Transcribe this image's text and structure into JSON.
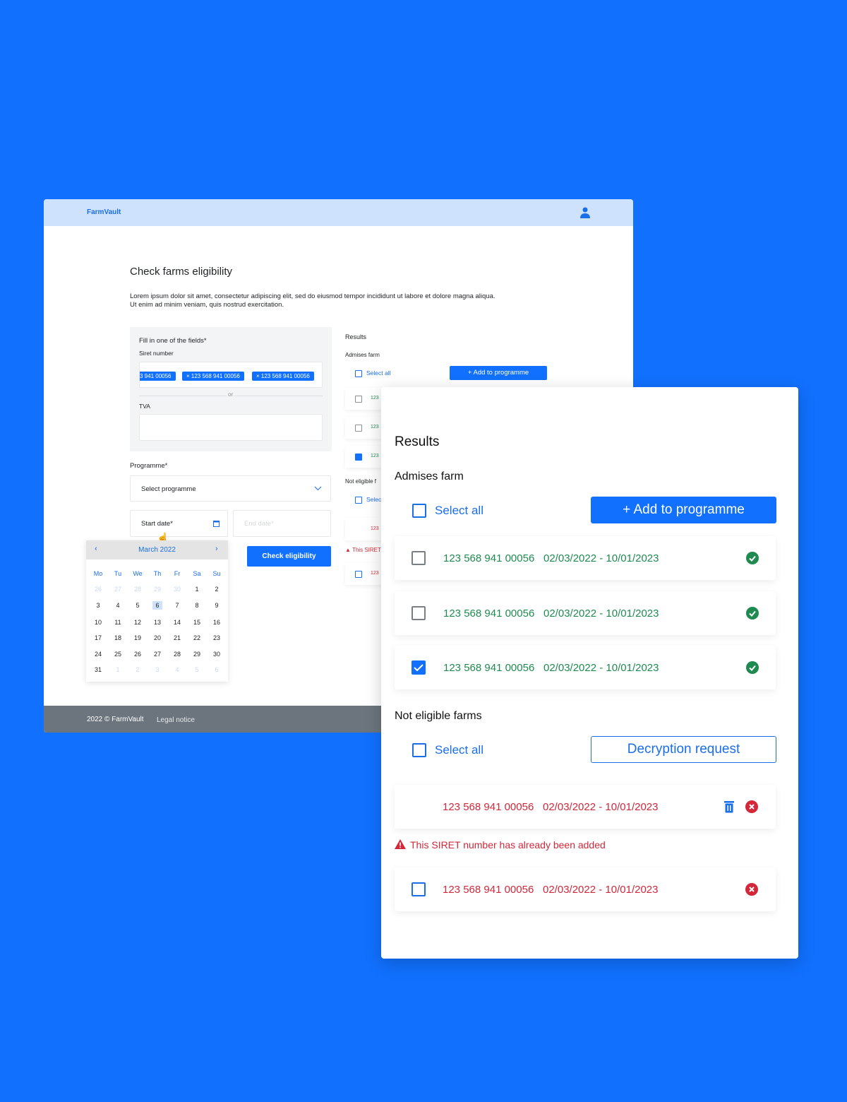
{
  "app": {
    "brand": "FarmVault"
  },
  "page": {
    "title": "Check farms eligibility",
    "description_line1": "Lorem ipsum dolor sit amet, consectetur adipiscing elit, sed do eiusmod tempor incididunt ut labore et dolore magna aliqua.",
    "description_line2": "Ut enim ad minim veniam, quis nostrud exercitation."
  },
  "form": {
    "fill_label": "Fill in one of the fields*",
    "siret_label": "Siret number",
    "siret_chips": [
      "3 941 00056",
      "× 123 568 941 00056",
      "× 123 568 941 00056"
    ],
    "or": "or",
    "tva_label": "TVA",
    "tva_value": "",
    "programme_label": "Programme*",
    "programme_placeholder": "Select programme",
    "start_date": "Start date*",
    "end_date_placeholder": "End date*",
    "check_button": "Check eligibility"
  },
  "calendar": {
    "month": "March 2022",
    "weekdays": [
      "Mo",
      "Tu",
      "We",
      "Th",
      "Fr",
      "Sa",
      "Su"
    ],
    "weeks": [
      [
        "26",
        "27",
        "28",
        "29",
        "30",
        "1",
        "2"
      ],
      [
        "3",
        "4",
        "5",
        "6",
        "7",
        "8",
        "9"
      ],
      [
        "10",
        "11",
        "12",
        "13",
        "14",
        "15",
        "16"
      ],
      [
        "17",
        "18",
        "19",
        "20",
        "21",
        "22",
        "23"
      ],
      [
        "24",
        "25",
        "26",
        "27",
        "28",
        "29",
        "30"
      ],
      [
        "31",
        "1",
        "2",
        "3",
        "4",
        "5",
        "6"
      ]
    ],
    "selected": "6"
  },
  "results": {
    "title": "Results",
    "admissible_title": "Admises farm",
    "select_all": "Select all",
    "add_button": "+ Add to programme",
    "admissible": [
      {
        "siret": "123 568 941 00056",
        "dates": "02/03/2022 - 10/01/2023",
        "checked": false
      },
      {
        "siret": "123 568 941 00056",
        "dates": "02/03/2022 - 10/01/2023",
        "checked": false
      },
      {
        "siret": "123 568 941 00056",
        "dates": "02/03/2022 - 10/01/2023",
        "checked": true
      }
    ],
    "not_eligible_title": "Not eligible farms",
    "not_eligible_title_short": "Not eligible f",
    "select_short": "Selec",
    "decryption_button": "Decryption request",
    "not_eligible": [
      {
        "siret": "123 568 941 00056",
        "dates": "02/03/2022 - 10/01/2023"
      },
      {
        "siret": "123 568 941 00056",
        "dates": "02/03/2022 - 10/01/2023"
      }
    ],
    "warning": "This SIRET number has already been added",
    "warning_short": "This SIRET",
    "short_siret": "123"
  },
  "footer": {
    "copyright": "2022 © FarmVault",
    "legal": "Legal notice"
  },
  "colors": {
    "background": "#1170fd",
    "accent": "#1170fd",
    "success": "#1f8a50",
    "error": "#d2283a",
    "header": "#cfe2fd",
    "footer": "#6c757d"
  }
}
